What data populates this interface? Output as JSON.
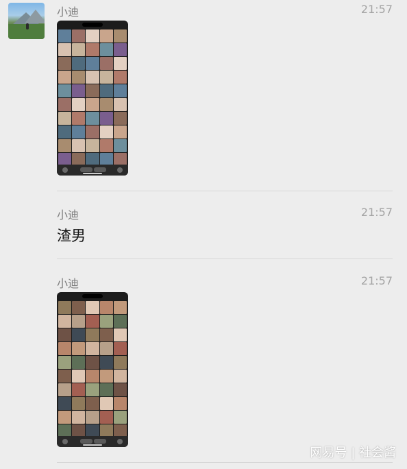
{
  "messages": [
    {
      "sender": "小迪",
      "time": "21:57",
      "type": "image",
      "image_desc": "photo-album-grid-screenshot"
    },
    {
      "sender": "小迪",
      "time": "21:57",
      "type": "text",
      "text": "渣男"
    },
    {
      "sender": "小迪",
      "time": "21:57",
      "type": "image",
      "image_desc": "photo-album-grid-screenshot"
    }
  ],
  "watermark": "网易号 | 社会酱",
  "colors": {
    "background": "#ededed",
    "sender": "#7d7d7d",
    "time": "#a4a4a4",
    "divider": "#d7d7d7"
  }
}
